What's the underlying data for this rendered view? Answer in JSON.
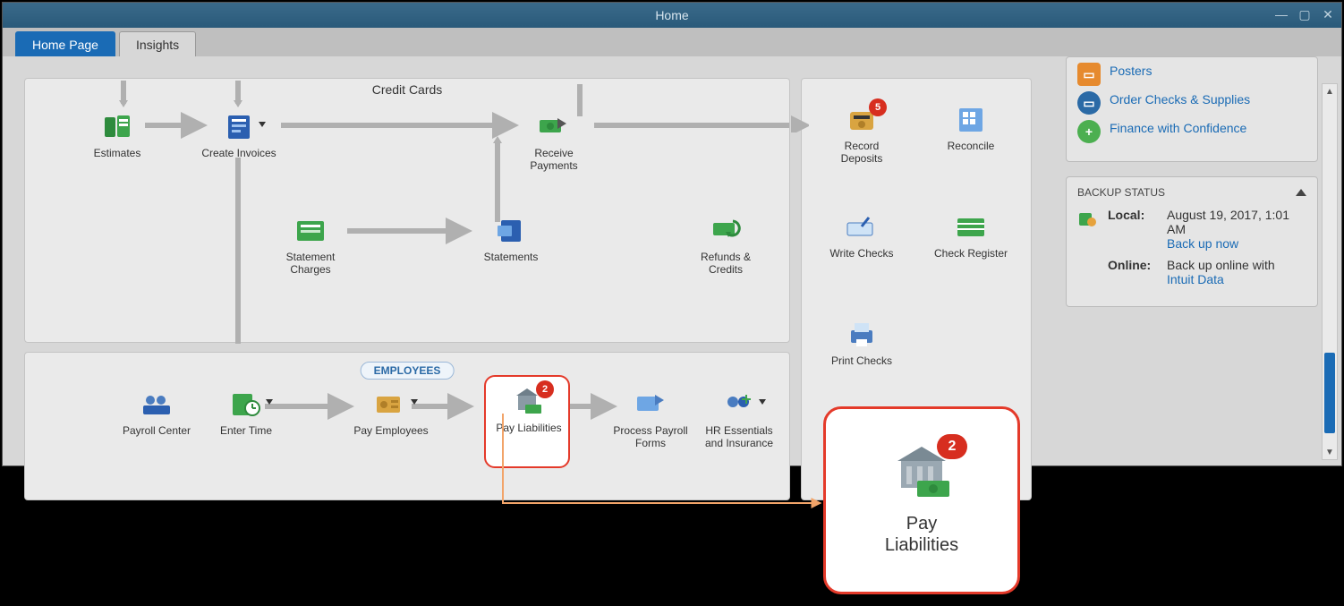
{
  "window": {
    "title": "Home"
  },
  "tabs": {
    "home": "Home Page",
    "insights": "Insights"
  },
  "partialTopText": "Credit Cards",
  "employeesHeader": "EMPLOYEES",
  "workflow": {
    "estimates": "Estimates",
    "createInvoices": "Create Invoices",
    "receivePayments": "Receive Payments",
    "statementCharges": "Statement Charges",
    "statements": "Statements",
    "refundsCredits": "Refunds & Credits",
    "payrollCenter": "Payroll Center",
    "enterTime": "Enter Time",
    "payEmployees": "Pay Employees",
    "payLiabilities": "Pay Liabilities",
    "processPayrollForms": "Process Payroll Forms",
    "hrEssentials": "HR Essentials and Insurance"
  },
  "banking": {
    "recordDeposits": "Record Deposits",
    "recordDepositsBadge": "5",
    "reconcile": "Reconcile",
    "writeChecks": "Write Checks",
    "checkRegister": "Check Register",
    "printChecks": "Print Checks"
  },
  "payLiabilitiesBadge": "2",
  "sidebar": {
    "partialTop": "Posters",
    "orderChecks": "Order Checks & Supplies",
    "finance": "Finance with Confidence"
  },
  "backup": {
    "header": "BACKUP STATUS",
    "localLabel": "Local:",
    "localValue": "August 19, 2017, 1:01 AM",
    "localLink": "Back up now",
    "onlineLabel": "Online:",
    "onlineValue": "Back up online with",
    "onlineLink": "Intuit Data"
  },
  "popout": {
    "label": "Pay Liabilities",
    "badge": "2"
  }
}
